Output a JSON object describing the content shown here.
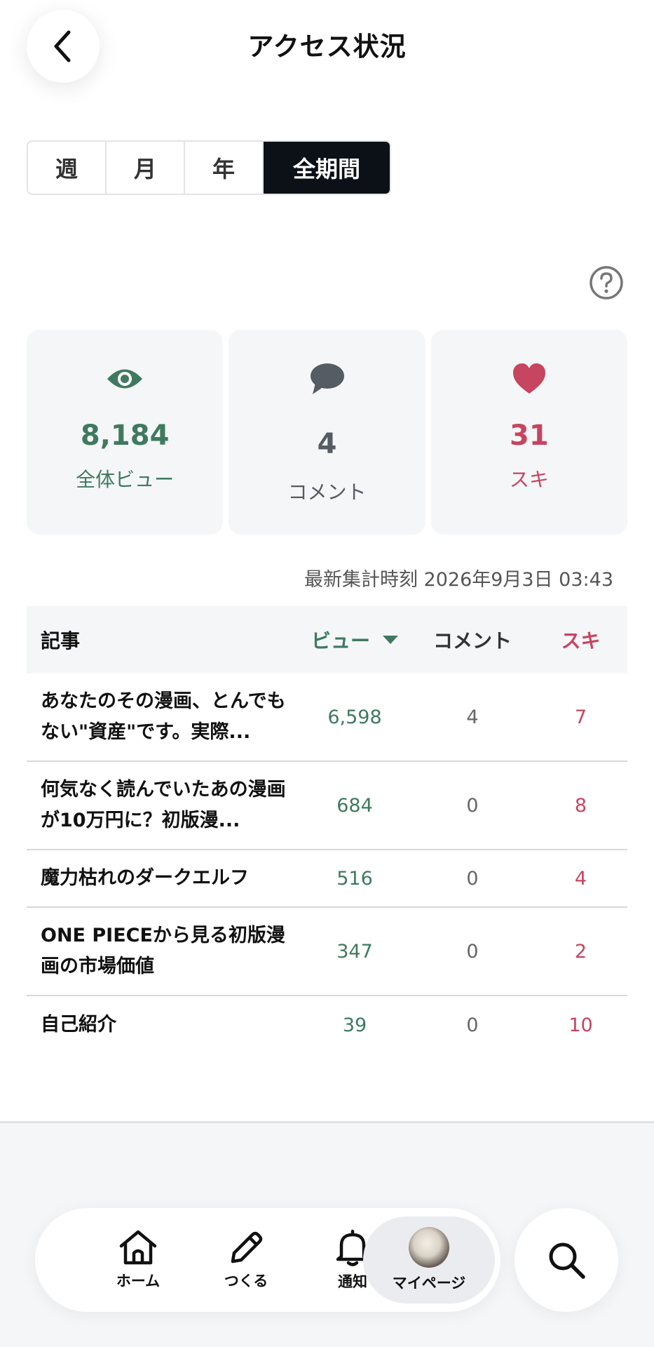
{
  "header": {
    "title": "アクセス状況"
  },
  "tabs": [
    {
      "label": "週"
    },
    {
      "label": "月"
    },
    {
      "label": "年"
    },
    {
      "label": "全期間",
      "active": true
    }
  ],
  "stats": {
    "views": {
      "value": "8,184",
      "label": "全体ビュー",
      "color": "#3f7a5f",
      "icon": "eye-icon"
    },
    "comments": {
      "value": "4",
      "label": "コメント",
      "color": "#555c63",
      "icon": "comment-icon"
    },
    "likes": {
      "value": "31",
      "label": "スキ",
      "color": "#c64560",
      "icon": "heart-icon"
    }
  },
  "updated_at": "最新集計時刻 2026年9月3日 03:43",
  "table": {
    "headers": {
      "title": "記事",
      "views": "ビュー",
      "comments": "コメント",
      "likes": "スキ"
    },
    "rows": [
      {
        "title": "あなたのその漫画、とんでもない\"資産\"です。実際...",
        "views": "6,598",
        "comments": "4",
        "likes": "7"
      },
      {
        "title": "何気なく読んでいたあの漫画が10万円に？初版漫...",
        "views": "684",
        "comments": "0",
        "likes": "8"
      },
      {
        "title": "魔力枯れのダークエルフ",
        "views": "516",
        "comments": "0",
        "likes": "4"
      },
      {
        "title": "ONE PIECEから見る初版漫画の市場価値",
        "views": "347",
        "comments": "0",
        "likes": "2"
      },
      {
        "title": "自己紹介",
        "views": "39",
        "comments": "0",
        "likes": "10"
      }
    ]
  },
  "nav": {
    "home": "ホーム",
    "create": "つくる",
    "notifications": "通知",
    "mypage": "マイページ"
  },
  "colors": {
    "accent_dark": "#0b1116",
    "view_green": "#3f7a5f",
    "like_pink": "#c64560"
  }
}
